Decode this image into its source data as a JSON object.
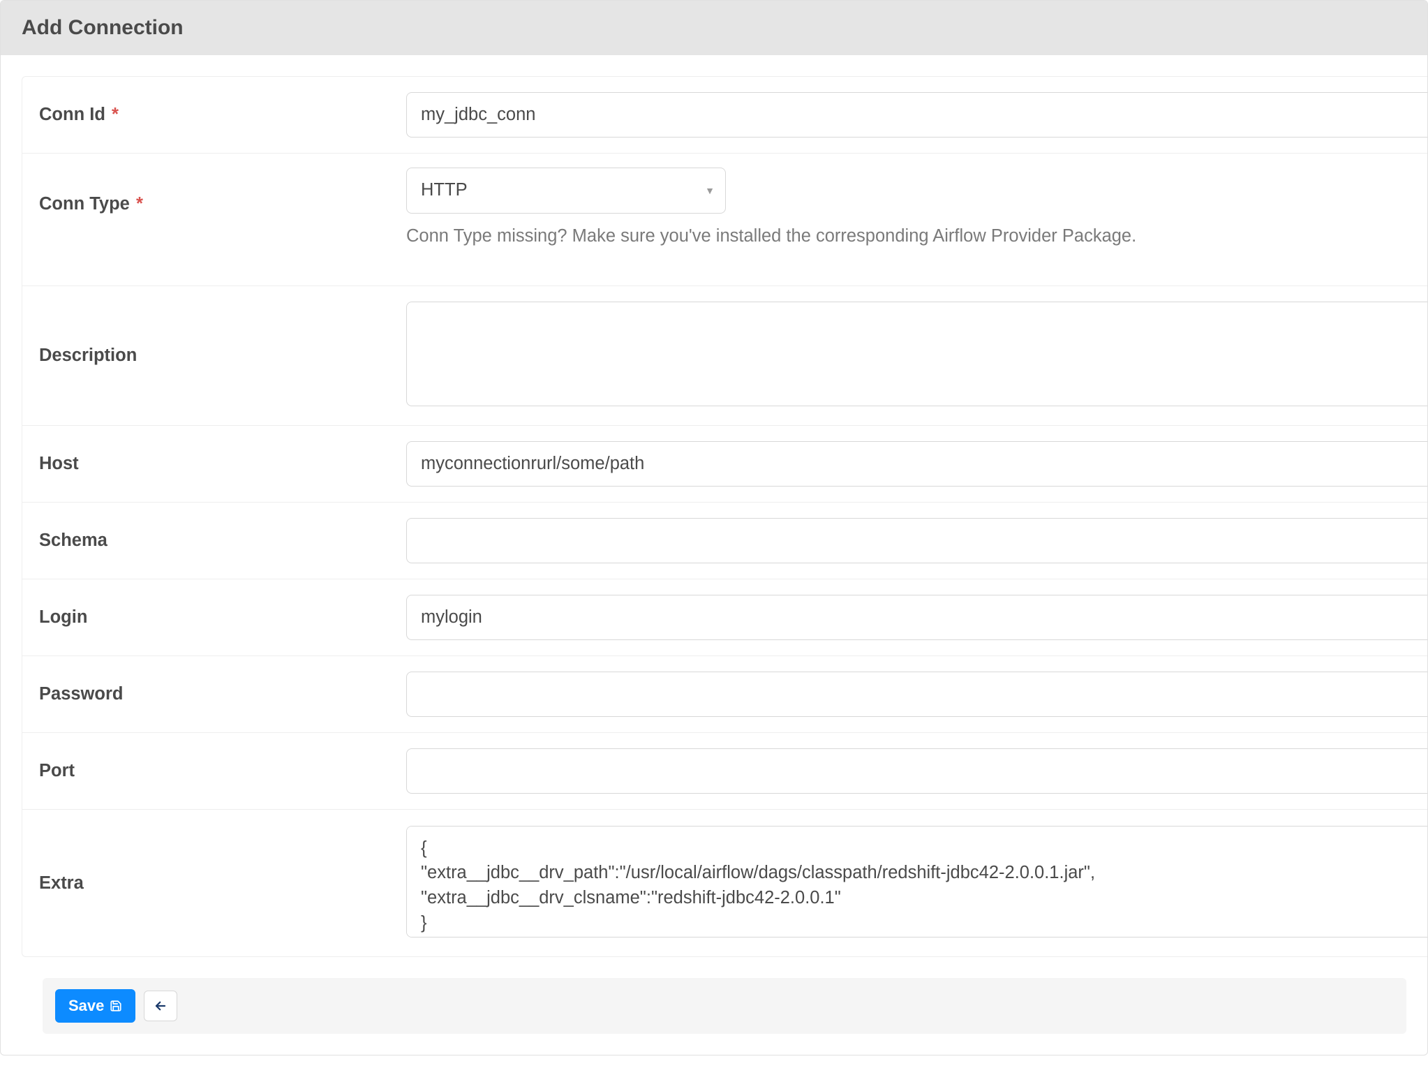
{
  "panel": {
    "title": "Add Connection"
  },
  "form": {
    "conn_id": {
      "label": "Conn Id",
      "required": true,
      "value": "my_jdbc_conn"
    },
    "conn_type": {
      "label": "Conn Type",
      "required": true,
      "value": "HTTP",
      "help": "Conn Type missing? Make sure you've installed the corresponding Airflow Provider Package."
    },
    "description": {
      "label": "Description",
      "value": ""
    },
    "host": {
      "label": "Host",
      "value": "myconnectionrurl/some/path"
    },
    "schema": {
      "label": "Schema",
      "value": ""
    },
    "login": {
      "label": "Login",
      "value": "mylogin"
    },
    "password": {
      "label": "Password",
      "value": ""
    },
    "port": {
      "label": "Port",
      "value": ""
    },
    "extra": {
      "label": "Extra",
      "value": "{\n\"extra__jdbc__drv_path\":\"/usr/local/airflow/dags/classpath/redshift-jdbc42-2.0.0.1.jar\",\n\"extra__jdbc__drv_clsname\":\"redshift-jdbc42-2.0.0.1\"\n}"
    }
  },
  "footer": {
    "save_label": "Save"
  }
}
